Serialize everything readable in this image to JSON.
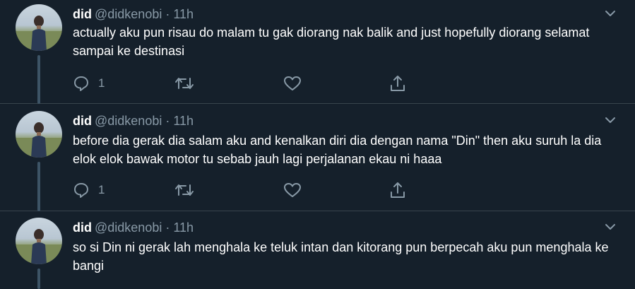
{
  "tweets": [
    {
      "display_name": "did",
      "handle": "@didkenobi",
      "separator": "·",
      "time": "11h",
      "text": "actually aku pun risau do malam tu gak diorang nak balik and just hopefully diorang selamat sampai ke destinasi",
      "reply_count": "1",
      "retweet_count": "",
      "like_count": ""
    },
    {
      "display_name": "did",
      "handle": "@didkenobi",
      "separator": "·",
      "time": "11h",
      "text": "before dia gerak dia salam aku and kenalkan diri dia dengan nama \"Din\" then aku suruh la dia elok elok bawak motor tu sebab jauh lagi perjalanan ekau ni haaa",
      "reply_count": "1",
      "retweet_count": "",
      "like_count": ""
    },
    {
      "display_name": "did",
      "handle": "@didkenobi",
      "separator": "·",
      "time": "11h",
      "text": "so si Din ni gerak lah menghala ke teluk intan dan kitorang pun berpecah aku pun menghala ke bangi",
      "reply_count": "",
      "retweet_count": "",
      "like_count": ""
    }
  ],
  "icons": {
    "reply": "reply-icon",
    "retweet": "retweet-icon",
    "like": "heart-icon",
    "share": "share-icon",
    "more": "chevron-down-icon"
  },
  "colors": {
    "background": "#15202b",
    "secondary_text": "#8899a6",
    "thread_line": "#3d5466",
    "divider": "#38444d"
  }
}
